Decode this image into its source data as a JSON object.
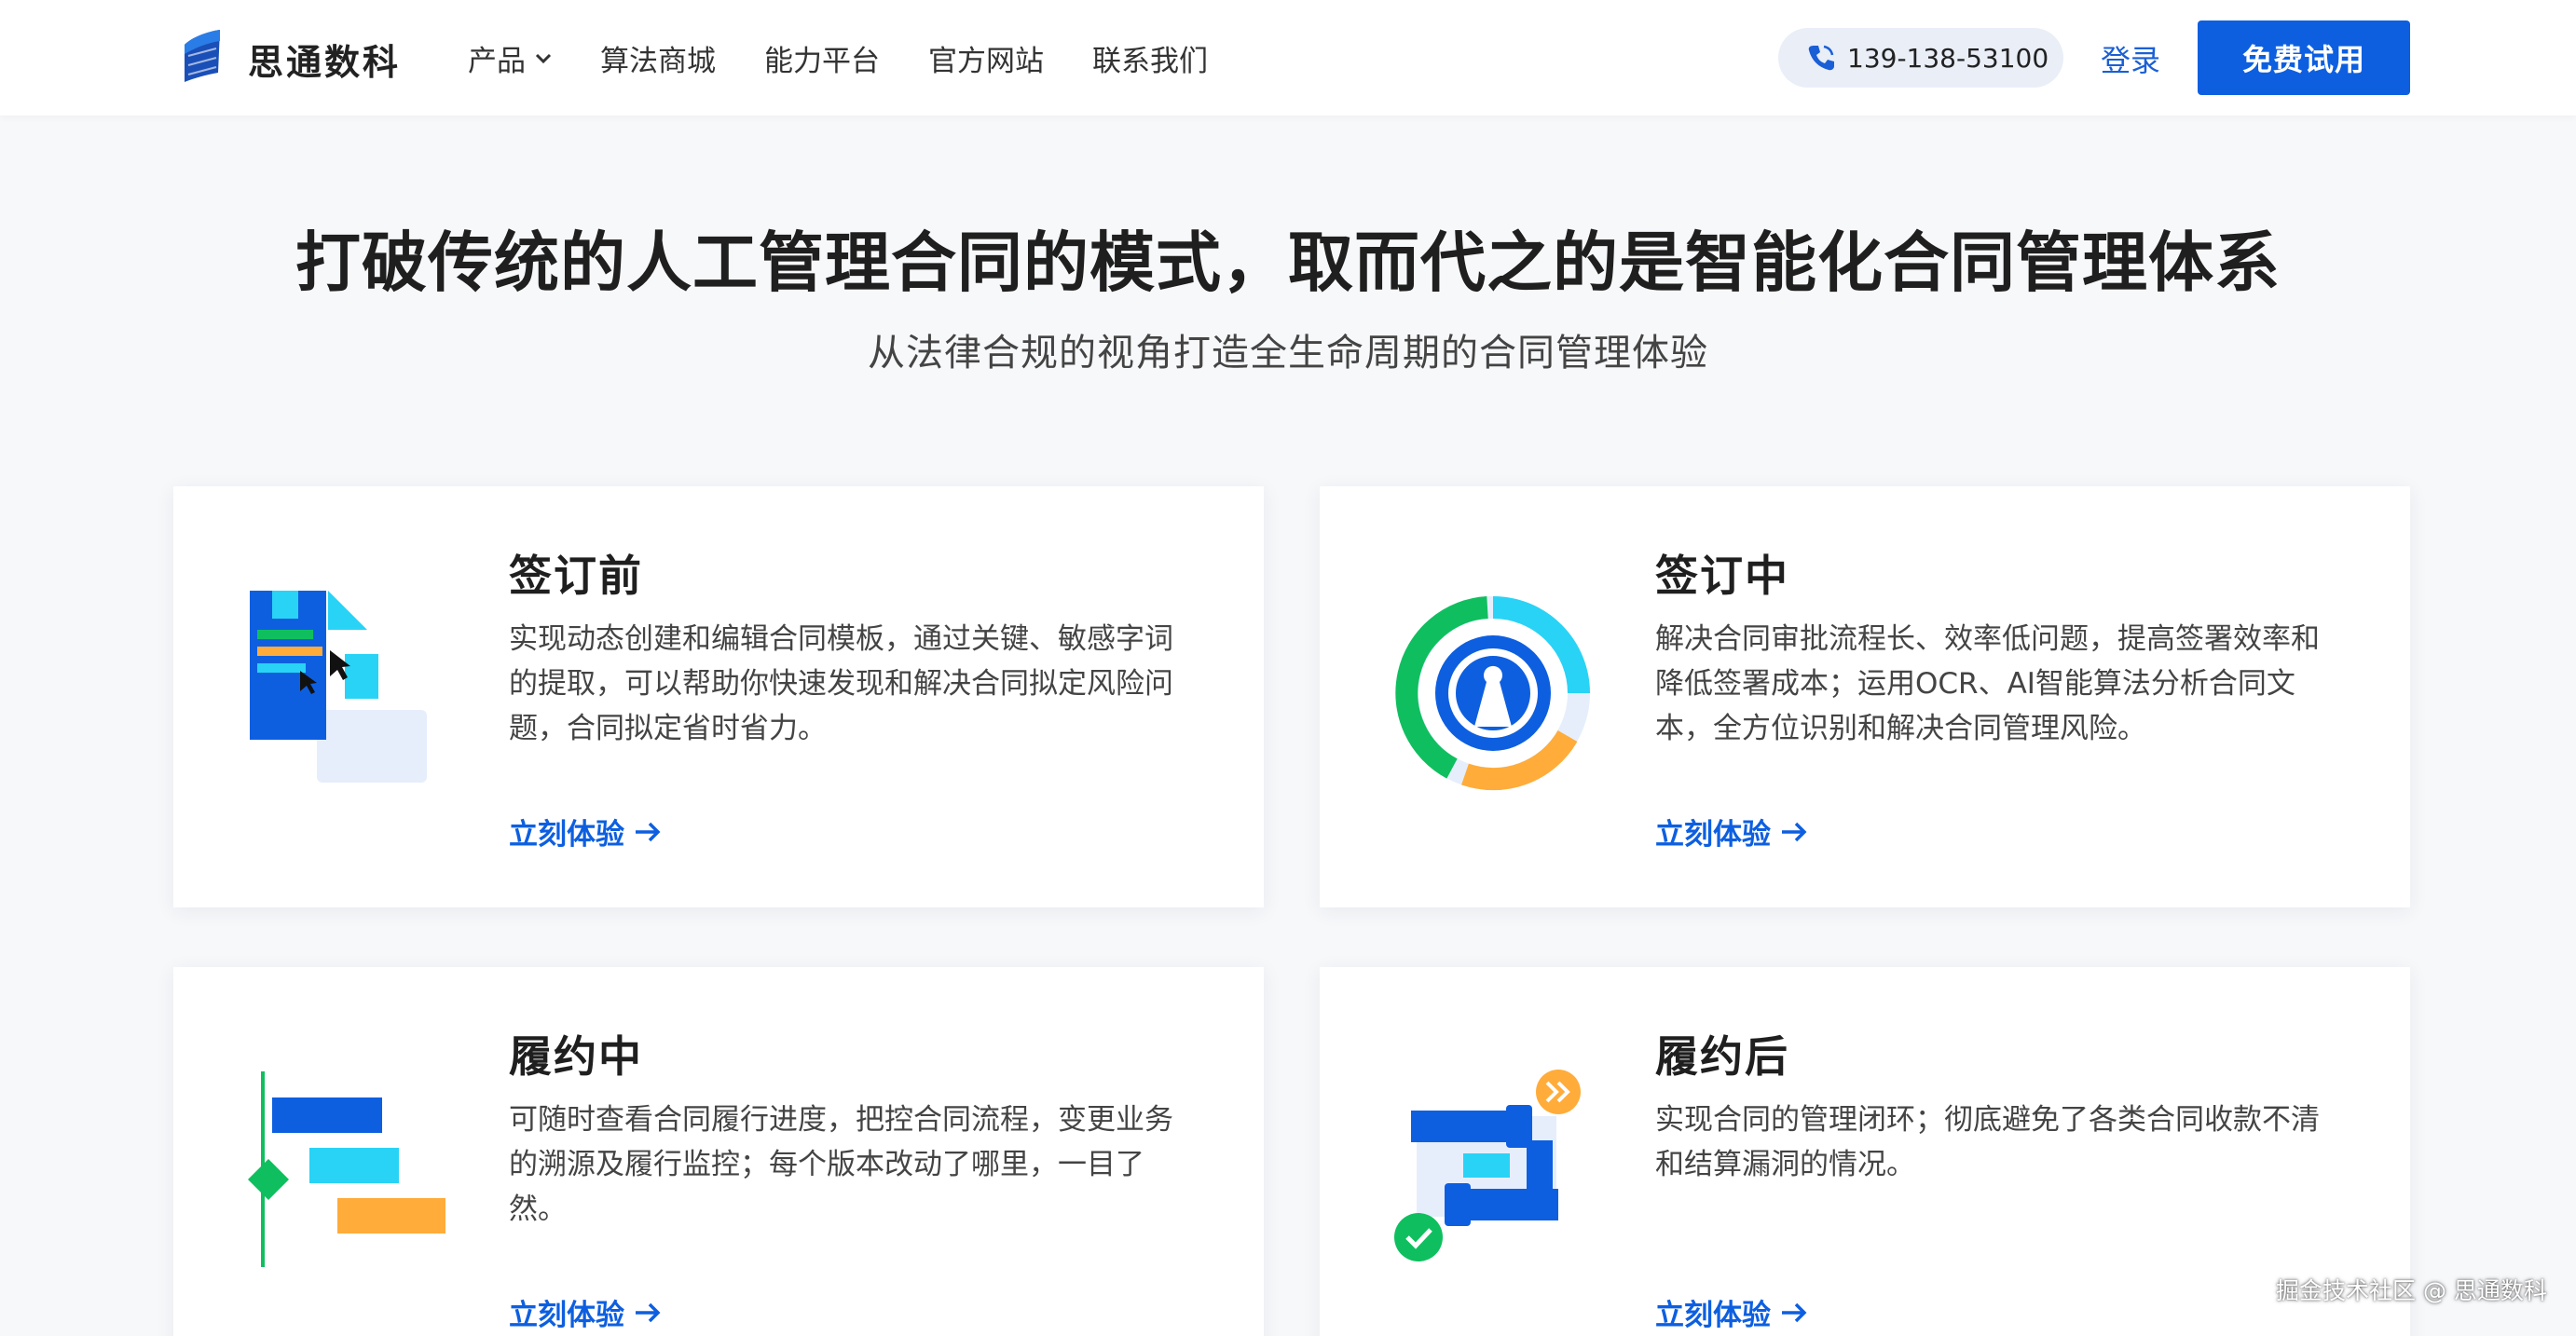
{
  "header": {
    "brand": "思通数科",
    "nav": [
      "产品",
      "算法商城",
      "能力平台",
      "官方网站",
      "联系我们"
    ],
    "phone": "139-138-53100",
    "login": "登录",
    "trial": "免费试用"
  },
  "hero": {
    "title": "打破传统的人工管理合同的模式，取而代之的是智能化合同管理体系",
    "subtitle": "从法律合规的视角打造全生命周期的合同管理体验"
  },
  "cards": [
    {
      "title": "签订前",
      "desc": "实现动态创建和编辑合同模板，通过关键、敏感字词的提取，可以帮助你快速发现和解决合同拟定风险问题，合同拟定省时省力。",
      "link": "立刻体验",
      "icon": "document-edit-illustration"
    },
    {
      "title": "签订中",
      "desc": "解决合同审批流程长、效率低问题，提高签署效率和降低签署成本；运用OCR、AI智能算法分析合同文本，全方位识别和解决合同管理风险。",
      "link": "立刻体验",
      "icon": "ring-chart-illustration"
    },
    {
      "title": "履约中",
      "desc": "可随时查看合同履行进度，把控合同流程，变更业务的溯源及履行监控；每个版本改动了哪里，一目了然。",
      "link": "立刻体验",
      "icon": "gantt-illustration"
    },
    {
      "title": "履约后",
      "desc": "实现合同的管理闭环；彻底避免了各类合同收款不清和结算漏洞的情况。",
      "link": "立刻体验",
      "icon": "loop-check-illustration"
    }
  ],
  "watermark": "掘金技术社区 @ 思通数科",
  "colors": {
    "primary": "#0d5fe0",
    "cyan": "#29d3f5",
    "green": "#0fbf5f",
    "orange": "#ffac3a"
  }
}
